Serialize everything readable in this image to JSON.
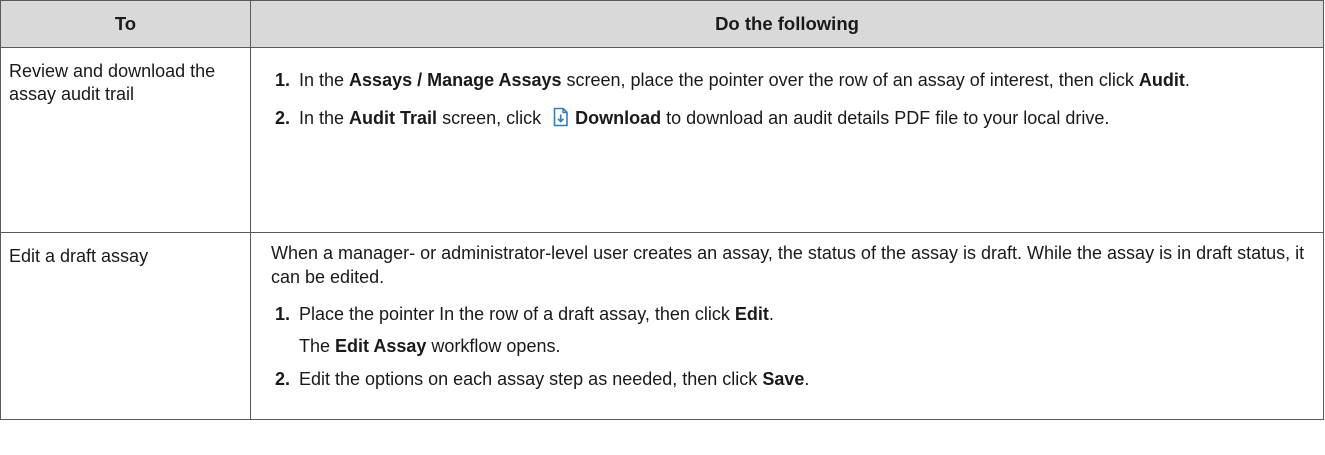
{
  "table": {
    "headers": {
      "to": "To",
      "do": "Do the following"
    },
    "rows": [
      {
        "to": "Review and download the assay audit trail",
        "steps": [
          {
            "num": "1.",
            "t1": "In the ",
            "b1": "Assays / Manage Assays",
            "t2": " screen, place the pointer over the row of an assay of interest, then click ",
            "b2": "Audit",
            "t3": "."
          },
          {
            "num": "2.",
            "t1": "In the ",
            "b1": "Audit Trail",
            "t2": " screen, click ",
            "icon": "download-file-icon",
            "b2": "Download",
            "t3": " to download an audit details PDF file to your local drive."
          }
        ]
      },
      {
        "to": "Edit a draft assay",
        "intro": "When a manager- or administrator-level user creates an assay, the status of the assay is draft. While the assay is in draft status, it can be edited.",
        "steps": [
          {
            "num": "1.",
            "t1": "Place the pointer In the row of a draft assay, then click ",
            "b1": "Edit",
            "t2": ".",
            "result": {
              "t1": "The ",
              "b1": "Edit Assay",
              "t2": " workflow opens."
            }
          },
          {
            "num": "2.",
            "t1": "Edit the options on each assay step as needed, then click ",
            "b1": "Save",
            "t2": "."
          }
        ]
      }
    ]
  },
  "colors": {
    "header_bg": "#d9d9d9",
    "border": "#5a5a5a",
    "icon_accent": "#2f7fc1"
  }
}
